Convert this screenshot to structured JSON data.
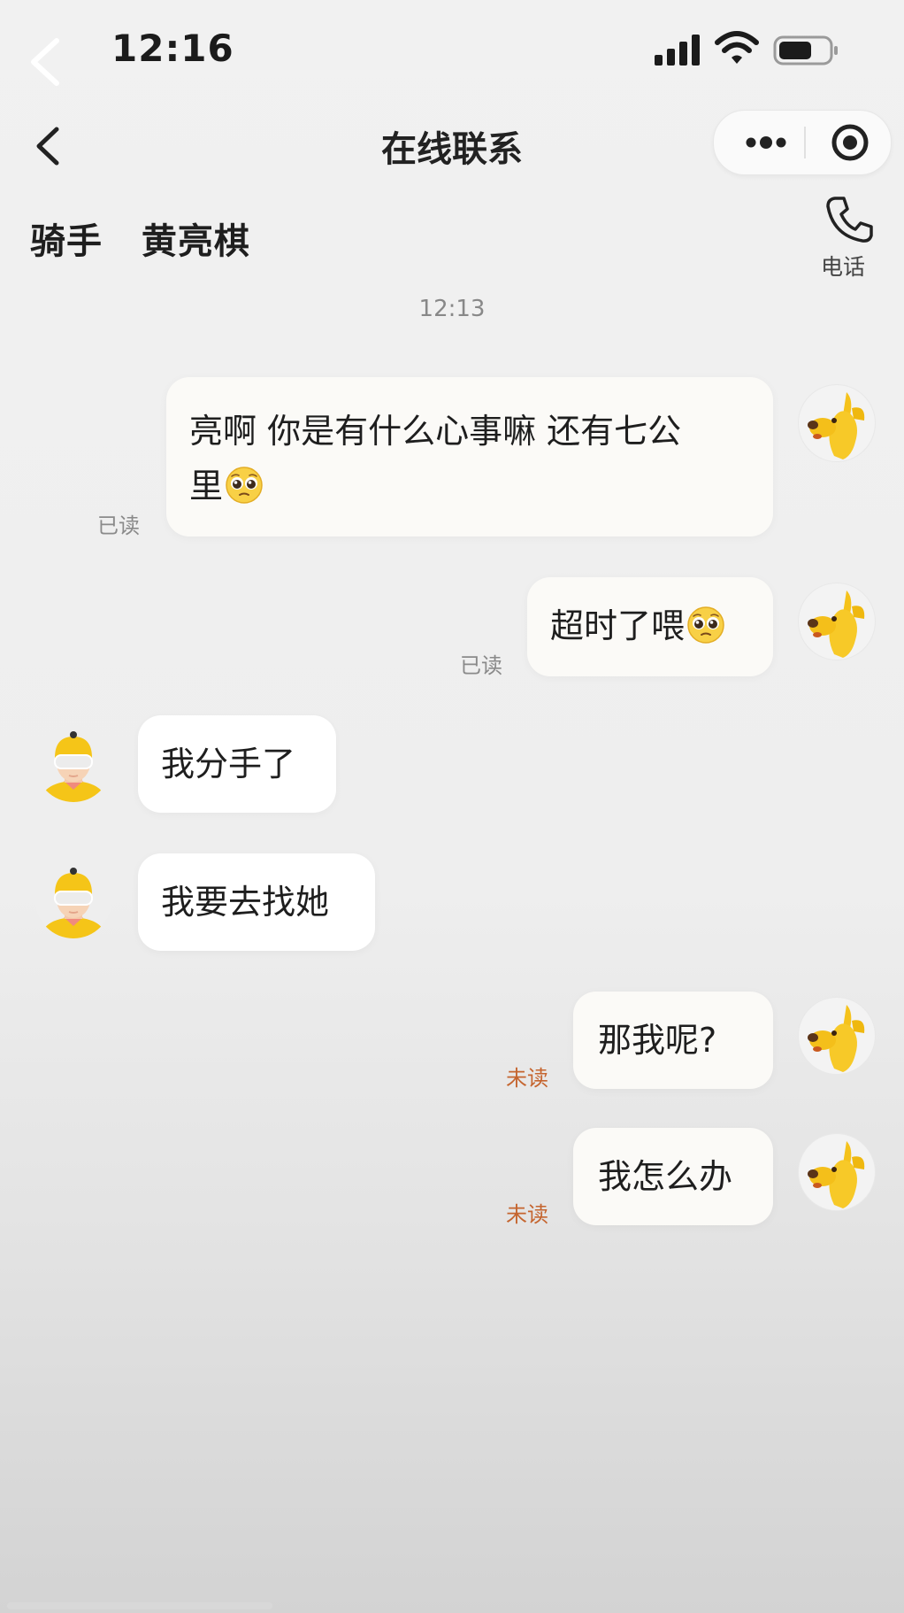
{
  "status_bar": {
    "time": "12:16"
  },
  "nav": {
    "title": "在线联系"
  },
  "contact": {
    "role": "骑手",
    "name": "黄亮棋",
    "phone_label": "电话"
  },
  "chat": {
    "timestamp": "12:13",
    "messages": [
      {
        "side": "out",
        "text": "亮啊 你是有什么心事嘛 还有七公",
        "text_line2": "里",
        "emoji": "pleading-face",
        "status": "已读"
      },
      {
        "side": "out",
        "text": "超时了喂",
        "emoji": "pleading-face",
        "status": "已读"
      },
      {
        "side": "in",
        "text": "我分手了"
      },
      {
        "side": "in",
        "text": "我要去找她"
      },
      {
        "side": "out",
        "text": "那我呢?",
        "status": "未读"
      },
      {
        "side": "out",
        "text": "我怎么办",
        "status": "未读"
      }
    ]
  },
  "colors": {
    "read": "#8a8a8a",
    "unread": "#c5652f",
    "avatar_yellow": "#f5c518"
  },
  "icons": {
    "status_back": "chevron-left-icon",
    "nav_back": "chevron-left-icon",
    "more": "more-dots-icon",
    "close": "target-close-icon",
    "phone": "phone-icon",
    "emoji": "pleading-face-emoji"
  }
}
